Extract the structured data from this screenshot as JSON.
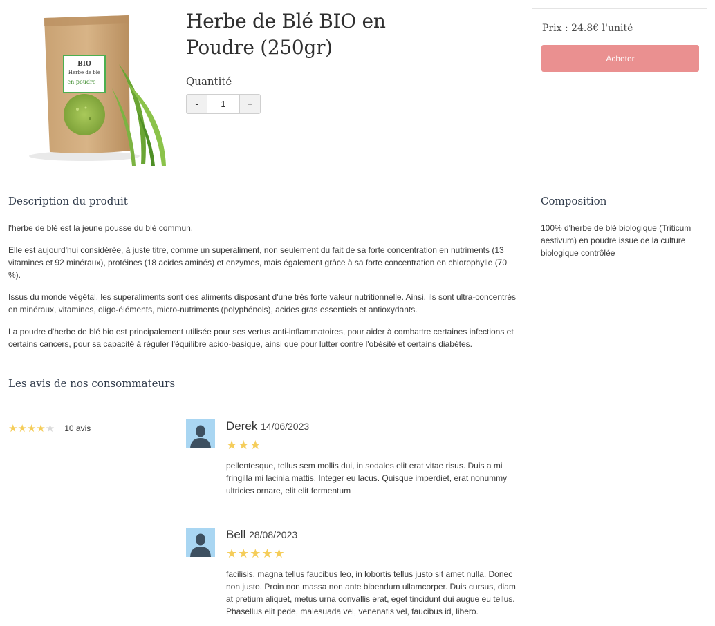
{
  "product": {
    "title": "Herbe de Blé BIO en Poudre (250gr)",
    "package_label_line1": "BIO",
    "package_label_line2": "Herbe de blé",
    "package_label_line3": "en poudre",
    "quantity_label": "Quantité",
    "quantity_value": "1",
    "decrement_label": "-",
    "increment_label": "+"
  },
  "purchase": {
    "price_text": "Prix : 24.8€ l'unité",
    "buy_label": "Acheter",
    "button_color": "#ea9090"
  },
  "description": {
    "title": "Description du produit",
    "paragraphs": [
      "l'herbe de blé est la jeune pousse du blé commun.",
      "Elle est aujourd'hui considérée, à juste titre, comme un superaliment, non seulement du fait de sa forte concentration en nutriments (13 vitamines et 92 minéraux), protéines (18 acides aminés) et enzymes, mais également grâce à sa forte concentration en chlorophylle (70 %).",
      "Issus du monde végétal, les superaliments sont des aliments disposant d'une très forte valeur nutritionnelle. Ainsi, ils sont ultra-concentrés en minéraux, vitamines, oligo-éléments, micro-nutriments (polyphénols), acides gras essentiels et antioxydants.",
      "La poudre d'herbe de blé bio est principalement utilisée pour ses vertus anti-inflammatoires, pour aider à combattre certaines infections et certains cancers, pour sa capacité à réguler l'équilibre acido-basique, ainsi que pour lutter contre l'obésité et certains diabètes."
    ]
  },
  "composition": {
    "title": "Composition",
    "text": "100% d'herbe de blé biologique (Triticum aestivum) en poudre issue de la culture biologique contrôlée"
  },
  "reviews": {
    "title": "Les avis de nos consommateurs",
    "summary_rating": 4,
    "summary_max": 5,
    "summary_stars_on": "★★★★",
    "summary_stars_off": "★",
    "count_text": "10 avis",
    "star_color": "#f5cd5a",
    "items": [
      {
        "author": "Derek",
        "date": "14/06/2023",
        "rating": 3,
        "stars": "★★★",
        "text": "pellentesque, tellus sem mollis dui, in sodales elit erat vitae risus. Duis a mi fringilla mi lacinia mattis. Integer eu lacus. Quisque imperdiet, erat nonummy ultricies ornare, elit elit fermentum"
      },
      {
        "author": "Bell",
        "date": "28/08/2023",
        "rating": 5,
        "stars": "★★★★★",
        "text": "facilisis, magna tellus faucibus leo, in lobortis tellus justo sit amet nulla. Donec non justo. Proin non massa non ante bibendum ullamcorper. Duis cursus, diam at pretium aliquet, metus urna convallis erat, eget tincidunt dui augue eu tellus. Phasellus elit pede, malesuada vel, venenatis vel, faucibus id, libero."
      }
    ]
  }
}
